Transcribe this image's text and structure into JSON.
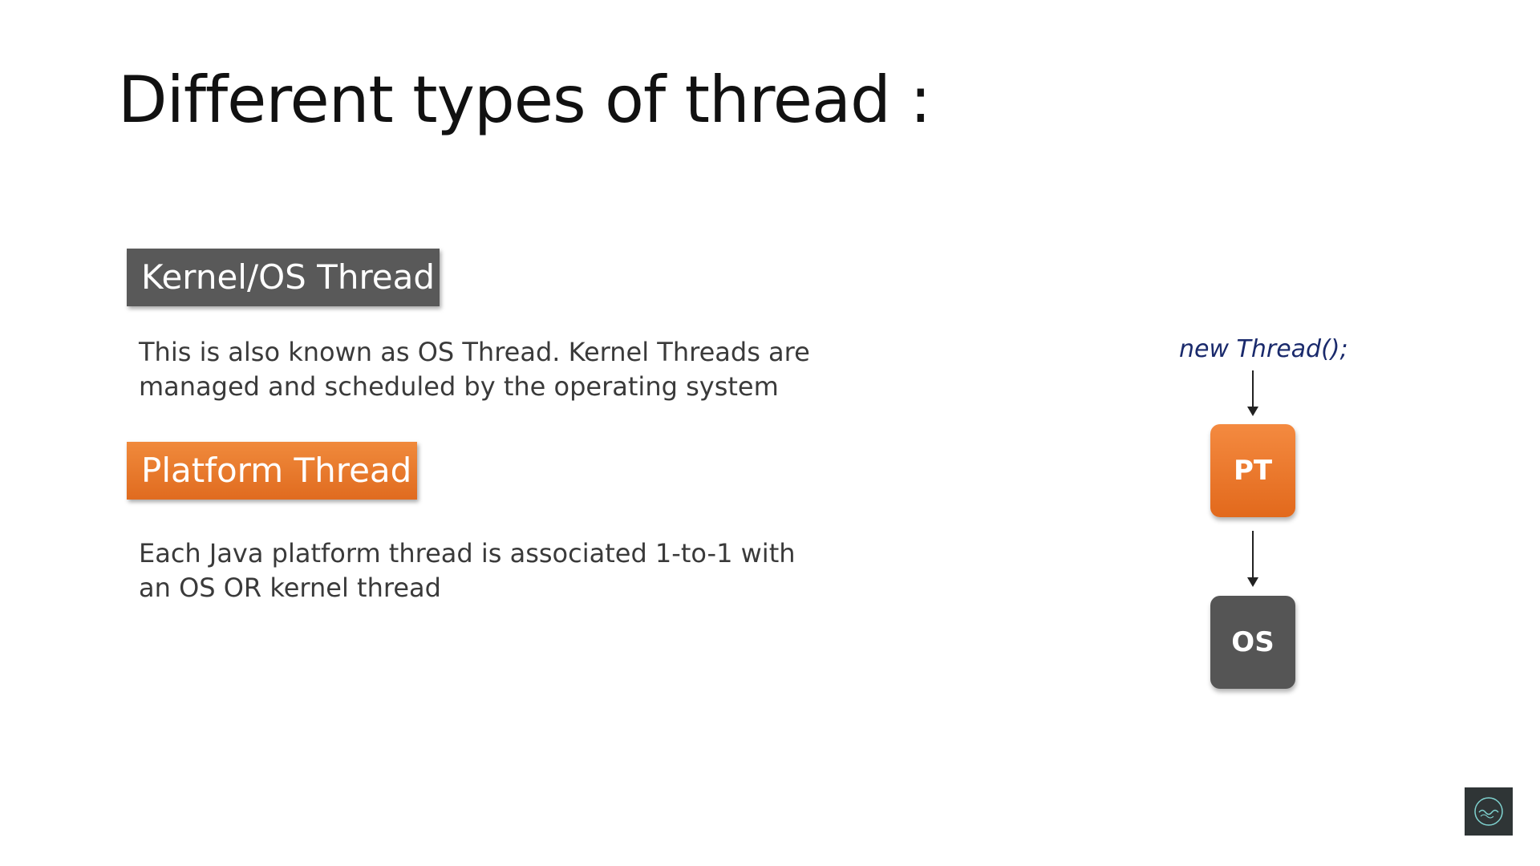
{
  "slide": {
    "title": "Different types of thread :",
    "kernel": {
      "label": "Kernel/OS Thread",
      "description": "This is also known as OS Thread. Kernel Threads are managed and scheduled by the operating system"
    },
    "platform": {
      "label": "Platform Thread",
      "description": "Each Java platform thread is associated 1-to-1 with an OS OR kernel thread"
    }
  },
  "diagram": {
    "code": "new Thread();",
    "node_pt": "PT",
    "node_os": "OS"
  },
  "colors": {
    "kernel_box": "#595959",
    "platform_box": "#e8782b",
    "pt_node": "#ec7a2c",
    "os_node": "#555555",
    "code_text": "#1a2a6c"
  },
  "icons": {
    "logo": "channel-logo-icon"
  }
}
